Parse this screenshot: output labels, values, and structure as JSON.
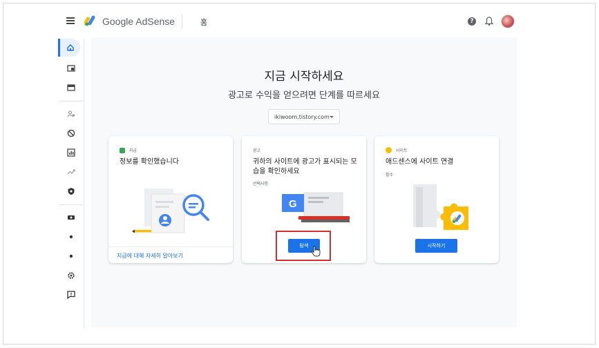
{
  "app": {
    "logo_text": "Google AdSense",
    "breadcrumb": "홈"
  },
  "header": {
    "help_icon": "help-icon",
    "notifications_icon": "bell-icon",
    "avatar": "avatar"
  },
  "sidebar": {
    "items": [
      {
        "icon": "home-icon"
      },
      {
        "icon": "ads-icon"
      },
      {
        "icon": "sites-icon"
      },
      {
        "icon": "users-icon"
      },
      {
        "icon": "block-icon"
      },
      {
        "icon": "reports-icon"
      },
      {
        "icon": "optimize-icon"
      },
      {
        "icon": "privacy-icon"
      },
      {
        "icon": "payments-icon"
      },
      {
        "icon": "dot-icon"
      },
      {
        "icon": "dot-icon"
      },
      {
        "icon": "settings-icon"
      },
      {
        "icon": "feedback-icon"
      }
    ]
  },
  "main": {
    "heading": "지금 시작하세요",
    "subheading": "광고로 수익을 얻으려면 단계를 따르세요",
    "site_select": "ikiwoom.tistory.com"
  },
  "cards": [
    {
      "tag": "지급",
      "tag_color": "#34a853",
      "title": "정보를 확인했습니다",
      "link": "지급에 대해 자세히 알아보기"
    },
    {
      "tag": "광고",
      "title": "귀하의 사이트에 광고가 표시되는 모습을 확인하세요",
      "sub": "선택사항",
      "button": "탐색"
    },
    {
      "tag": "사이트",
      "tag_color": "#fbbc04",
      "title": "애드센스에 사이트 연결",
      "sub": "필수",
      "button": "시작하기"
    }
  ],
  "colors": {
    "accent": "#1a73e8",
    "highlight": "#d32f2f"
  }
}
